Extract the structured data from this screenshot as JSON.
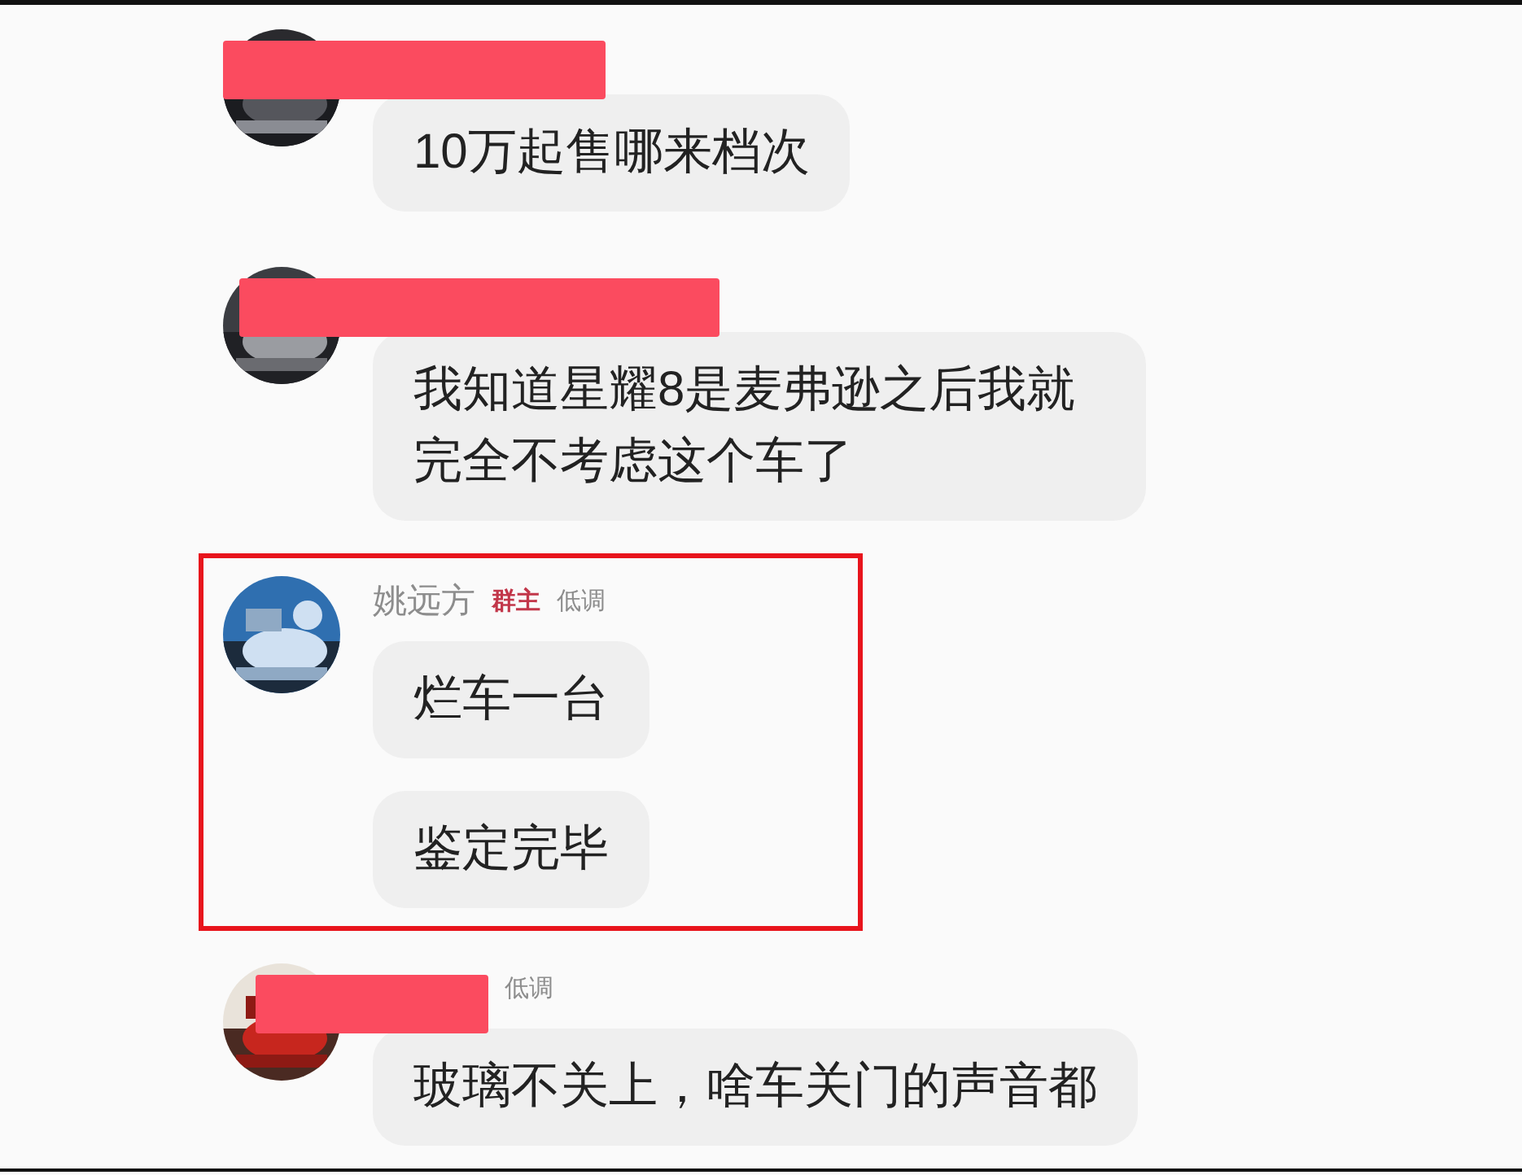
{
  "messages": [
    {
      "avatar": {
        "kind": "picture"
      },
      "redacted": true,
      "highlighted": false,
      "bubbles": [
        "10万起售哪来档次"
      ]
    },
    {
      "avatar": {
        "kind": "picture"
      },
      "redacted": true,
      "highlighted": false,
      "bubbles": [
        "我知道星耀8是麦弗逊之后我就完全不考虑这个车了"
      ]
    },
    {
      "avatar": {
        "kind": "picture"
      },
      "redacted": false,
      "highlighted": true,
      "name": "姚远方",
      "tags": [
        {
          "text": "群主",
          "kind": "owner"
        },
        {
          "text": "低调",
          "kind": "level"
        }
      ],
      "bubbles": [
        "烂车一台",
        "鉴定完毕"
      ]
    },
    {
      "avatar": {
        "kind": "picture"
      },
      "redacted": true,
      "highlighted": false,
      "tags": [
        {
          "text": "低调",
          "kind": "level"
        }
      ],
      "bubbles": [
        "玻璃不关上，啥车关门的声音都"
      ]
    }
  ]
}
